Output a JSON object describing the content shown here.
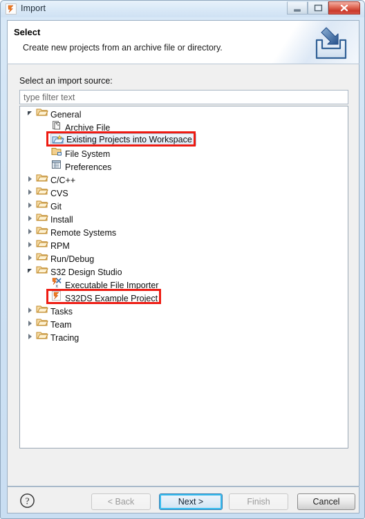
{
  "window": {
    "title": "Import",
    "icon": "s32ds-import-icon",
    "controls": {
      "minimize": "minimize-icon",
      "maximize": "maximize-icon",
      "close": "close-icon"
    }
  },
  "header": {
    "title": "Select",
    "description": "Create new projects from an archive file or directory.",
    "banner_icon": "import-tray-arrow-icon"
  },
  "body": {
    "source_label": "Select an import source:",
    "filter": {
      "value": "",
      "placeholder": "type filter text",
      "name": "filter-input"
    }
  },
  "tree": {
    "items": [
      {
        "label": "General",
        "depth": 0,
        "state": "expanded",
        "icon": "folder-open-icon",
        "selected": false,
        "highlighted": false
      },
      {
        "label": "Archive File",
        "depth": 1,
        "state": "leaf",
        "icon": "archive-file-icon",
        "selected": false,
        "highlighted": false
      },
      {
        "label": "Existing Projects into Workspace",
        "depth": 1,
        "state": "leaf",
        "icon": "existing-projects-icon",
        "selected": true,
        "highlighted": true
      },
      {
        "label": "File System",
        "depth": 1,
        "state": "leaf",
        "icon": "file-system-folder-icon",
        "selected": false,
        "highlighted": false
      },
      {
        "label": "Preferences",
        "depth": 1,
        "state": "leaf",
        "icon": "preferences-icon",
        "selected": false,
        "highlighted": false
      },
      {
        "label": "C/C++",
        "depth": 0,
        "state": "collapsed",
        "icon": "folder-open-icon",
        "selected": false,
        "highlighted": false
      },
      {
        "label": "CVS",
        "depth": 0,
        "state": "collapsed",
        "icon": "folder-open-icon",
        "selected": false,
        "highlighted": false
      },
      {
        "label": "Git",
        "depth": 0,
        "state": "collapsed",
        "icon": "folder-open-icon",
        "selected": false,
        "highlighted": false
      },
      {
        "label": "Install",
        "depth": 0,
        "state": "collapsed",
        "icon": "folder-open-icon",
        "selected": false,
        "highlighted": false
      },
      {
        "label": "Remote Systems",
        "depth": 0,
        "state": "collapsed",
        "icon": "folder-open-icon",
        "selected": false,
        "highlighted": false
      },
      {
        "label": "RPM",
        "depth": 0,
        "state": "collapsed",
        "icon": "folder-open-icon",
        "selected": false,
        "highlighted": false
      },
      {
        "label": "Run/Debug",
        "depth": 0,
        "state": "collapsed",
        "icon": "folder-open-icon",
        "selected": false,
        "highlighted": false
      },
      {
        "label": "S32 Design Studio",
        "depth": 0,
        "state": "expanded",
        "icon": "folder-open-icon",
        "selected": false,
        "highlighted": false
      },
      {
        "label": "Executable File Importer",
        "depth": 1,
        "state": "leaf",
        "icon": "executable-importer-icon",
        "selected": false,
        "highlighted": false
      },
      {
        "label": "S32DS Example Project",
        "depth": 1,
        "state": "leaf",
        "icon": "s32ds-project-icon",
        "selected": false,
        "highlighted": true
      },
      {
        "label": "Tasks",
        "depth": 0,
        "state": "collapsed",
        "icon": "folder-open-icon",
        "selected": false,
        "highlighted": false
      },
      {
        "label": "Team",
        "depth": 0,
        "state": "collapsed",
        "icon": "folder-open-icon",
        "selected": false,
        "highlighted": false
      },
      {
        "label": "Tracing",
        "depth": 0,
        "state": "collapsed",
        "icon": "folder-open-icon",
        "selected": false,
        "highlighted": false
      }
    ]
  },
  "footer": {
    "help_icon": "help-question-icon",
    "back_label": "< Back",
    "next_label": "Next >",
    "finish_label": "Finish",
    "cancel_label": "Cancel",
    "back_enabled": false,
    "next_enabled": true,
    "next_is_default": true,
    "finish_enabled": false,
    "cancel_enabled": true
  },
  "colors": {
    "annotation_red": "#ee1b12",
    "default_button_focus": "#35bbef",
    "folder_gold": "#e8b964",
    "dialog_background": "#f0f0f0"
  }
}
